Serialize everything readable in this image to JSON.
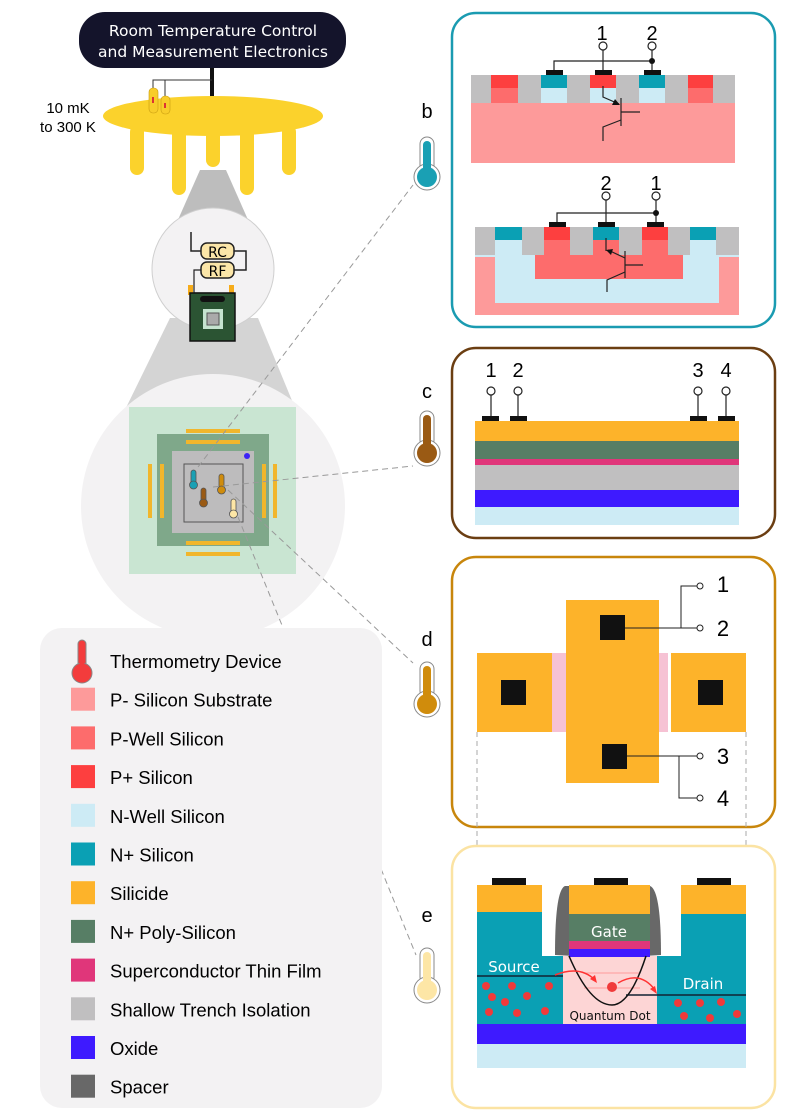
{
  "header": {
    "electronics_line1": "Room Temperature Control",
    "electronics_line2": "and Measurement Electronics",
    "temp_range_line1": "10 mK",
    "temp_range_line2": "to 300 K"
  },
  "filters": {
    "rc_label": "RC",
    "rf_label": "RF"
  },
  "panels": {
    "b": {
      "letter": "b",
      "border_color": "#1a9bb1",
      "thermo_color": "#1aa0b4",
      "top_pins": [
        "1",
        "2"
      ],
      "bottom_pins": [
        "2",
        "1"
      ]
    },
    "c": {
      "letter": "c",
      "border_color": "#6b3e12",
      "thermo_color": "#9a5a14",
      "pins": [
        "1",
        "2",
        "3",
        "4"
      ]
    },
    "d": {
      "letter": "d",
      "border_color": "#c8860c",
      "thermo_color": "#d08c0c",
      "pins": [
        "1",
        "2",
        "3",
        "4"
      ]
    },
    "e": {
      "letter": "e",
      "border_color": "#fbe3a3",
      "thermo_color": "#fde6a6",
      "gate_label": "Gate",
      "source_label": "Source",
      "drain_label": "Drain",
      "dot_label": "Quantum Dot"
    }
  },
  "legend": {
    "items": [
      {
        "label": "Thermometry Device",
        "color": "#f33c3c",
        "icon": "thermometer-icon"
      },
      {
        "label": "P- Silicon Substrate",
        "color": "#fd9a9a"
      },
      {
        "label": "P-Well Silicon",
        "color": "#fd6c6c"
      },
      {
        "label": "P+ Silicon",
        "color": "#fd3f3f"
      },
      {
        "label": "N-Well Silicon",
        "color": "#cdebf5"
      },
      {
        "label": "N+ Silicon",
        "color": "#0aa0b4"
      },
      {
        "label": "Silicide",
        "color": "#fdb32a"
      },
      {
        "label": "N+ Poly-Silicon",
        "color": "#577e65"
      },
      {
        "label": "Superconductor Thin Film",
        "color": "#e0367a"
      },
      {
        "label": "Shallow Trench Isolation",
        "color": "#c0bfc0"
      },
      {
        "label": "Oxide",
        "color": "#3e1aff"
      },
      {
        "label": "Spacer",
        "color": "#686868"
      }
    ]
  }
}
